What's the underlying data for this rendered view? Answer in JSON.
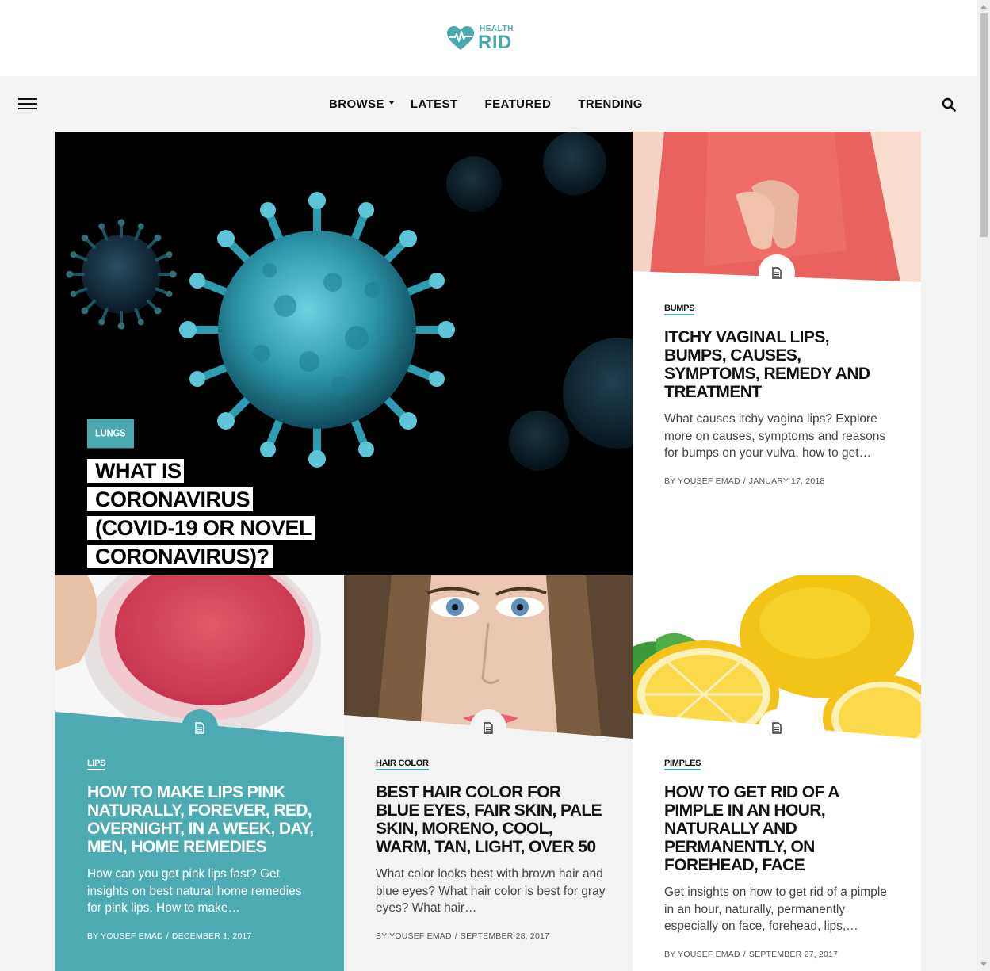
{
  "brand": {
    "line1": "HEALTH",
    "line2": "RID",
    "color": "#4aa9b0"
  },
  "nav": {
    "menu_icon": "hamburger-menu-icon",
    "items": [
      {
        "label": "BROWSE",
        "has_dropdown": true
      },
      {
        "label": "LATEST"
      },
      {
        "label": "FEATURED"
      },
      {
        "label": "TRENDING"
      }
    ],
    "search_icon": "search-icon"
  },
  "hero": {
    "category": "LUNGS",
    "title": "WHAT IS CORONAVIRUS (COVID-19 OR NOVEL CORONAVIRUS)?"
  },
  "cards": [
    {
      "category": "BUMPS",
      "title": "ITCHY VAGINAL LIPS, BUMPS, CAUSES, SYMPTOMS, REMEDY AND TREATMENT",
      "excerpt": "What causes itchy vagina lips? Explore more on causes, symptoms and reasons for bumps on your vulva, how to get…",
      "author": "BY YOUSEF EMAD",
      "date": "JANUARY 17, 2018"
    },
    {
      "category": "LIPS",
      "title": "HOW TO MAKE LIPS PINK NATURALLY, FOREVER, RED, OVERNIGHT, IN A WEEK, DAY, MEN, HOME REMEDIES",
      "excerpt": "How can you get pink lips fast? Get insights on best natural home remedies for pink lips. How to make…",
      "author": "BY YOUSEF EMAD",
      "date": "DECEMBER 1, 2017"
    },
    {
      "category": "HAIR COLOR",
      "title": "BEST HAIR COLOR FOR BLUE EYES, FAIR SKIN, PALE SKIN, MORENO, COOL, WARM, TAN, LIGHT, OVER 50",
      "excerpt": "What color looks best with brown hair and blue eyes? What hair color is best for gray eyes? What hair…",
      "author": "BY YOUSEF EMAD",
      "date": "SEPTEMBER 28, 2017"
    },
    {
      "category": "PIMPLES",
      "title": "HOW TO GET RID OF A PIMPLE IN AN HOUR, NATURALLY AND PERMANENTLY, ON FOREHEAD, FACE",
      "excerpt": "Get insights on how to get rid of a pimple in an hour, naturally, permanently especially on face, forehead, lips,…",
      "author": "BY YOUSEF EMAD",
      "date": "SEPTEMBER 27, 2017"
    }
  ],
  "meta_separator": "/",
  "colors": {
    "accent": "#4aa9b0",
    "teal_card": "#4fabb3"
  }
}
